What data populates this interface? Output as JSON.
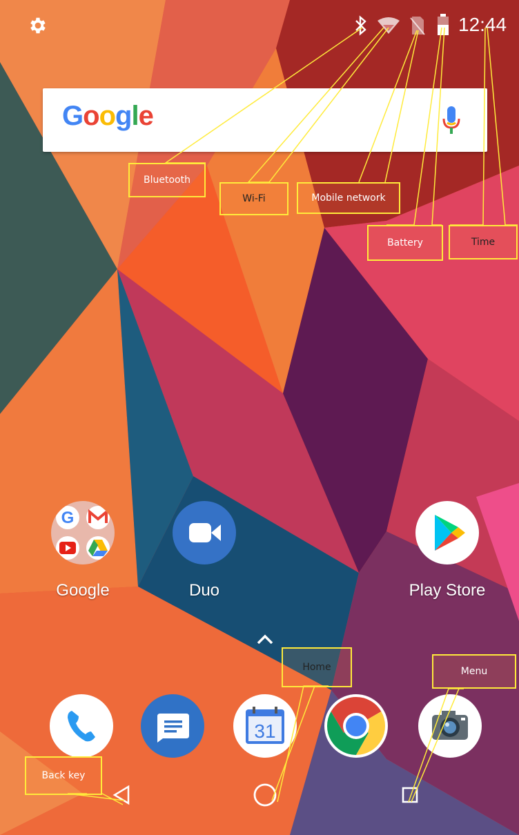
{
  "status_bar": {
    "settings_icon": "gear-icon",
    "bluetooth_icon": "bluetooth-icon",
    "wifi_icon": "wifi-icon",
    "mobile_icon": "mobile-network-icon",
    "battery_icon": "battery-icon",
    "time": "12:44"
  },
  "search": {
    "logo_letters": [
      "G",
      "o",
      "o",
      "g",
      "l",
      "e"
    ],
    "logo_colors": [
      "#4285F4",
      "#EA4335",
      "#FBBC05",
      "#4285F4",
      "#34A853",
      "#EA4335"
    ],
    "mic_icon": "microphone-icon"
  },
  "apps": [
    {
      "label": "Google",
      "icon": "google-folder-icon"
    },
    {
      "label": "Duo",
      "icon": "video-camera-icon"
    },
    {
      "label": "Play Store",
      "icon": "play-store-icon"
    }
  ],
  "drawer_handle_icon": "chevron-up-icon",
  "dock": [
    {
      "name": "phone",
      "icon": "phone-icon"
    },
    {
      "name": "messages",
      "icon": "message-icon"
    },
    {
      "name": "calendar",
      "icon": "calendar-icon",
      "text": "31"
    },
    {
      "name": "chrome",
      "icon": "chrome-icon"
    },
    {
      "name": "camera",
      "icon": "camera-icon"
    }
  ],
  "nav": {
    "back_icon": "back-triangle-icon",
    "home_icon": "home-circle-icon",
    "menu_icon": "recent-square-icon"
  },
  "annotations": {
    "bluetooth": "Bluetooth",
    "wifi": "Wi-Fi",
    "mobile": "Mobile network",
    "battery": "Battery",
    "time": "Time",
    "home": "Home",
    "menu": "Menu",
    "back": "Back key"
  },
  "colors": {
    "callout_border": "#ffeb3b",
    "accent_blue": "#4285F4"
  }
}
